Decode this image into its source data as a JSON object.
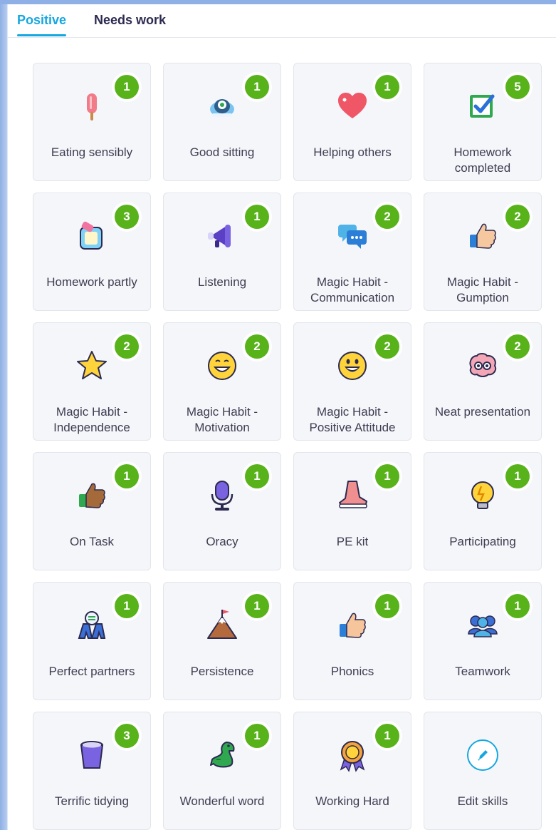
{
  "tabs": {
    "positive": "Positive",
    "needs_work": "Needs work"
  },
  "skills": [
    {
      "label": "Eating sensibly",
      "count": "1",
      "icon": "ice-lolly-icon"
    },
    {
      "label": "Good sitting",
      "count": "1",
      "icon": "monster-icon"
    },
    {
      "label": "Helping others",
      "count": "1",
      "icon": "heart-icon"
    },
    {
      "label": "Homework completed",
      "count": "5",
      "icon": "checkbox-icon"
    },
    {
      "label": "Homework partly",
      "count": "3",
      "icon": "eraser-note-icon"
    },
    {
      "label": "Listening",
      "count": "1",
      "icon": "megaphone-icon"
    },
    {
      "label": "Magic Habit - Communication",
      "count": "2",
      "icon": "speech-bubbles-icon"
    },
    {
      "label": "Magic Habit - Gumption",
      "count": "2",
      "icon": "thumbs-up-icon"
    },
    {
      "label": "Magic Habit - Independence",
      "count": "2",
      "icon": "star-icon"
    },
    {
      "label": "Magic Habit - Motivation",
      "count": "2",
      "icon": "grin-face-icon"
    },
    {
      "label": "Magic Habit - Positive Attitude",
      "count": "2",
      "icon": "smile-face-icon"
    },
    {
      "label": "Neat presentation",
      "count": "2",
      "icon": "brain-icon"
    },
    {
      "label": "On Task",
      "count": "1",
      "icon": "thumbs-up-brown-icon"
    },
    {
      "label": "Oracy",
      "count": "1",
      "icon": "microphone-icon"
    },
    {
      "label": "PE kit",
      "count": "1",
      "icon": "shoe-icon"
    },
    {
      "label": "Participating",
      "count": "1",
      "icon": "lightbulb-icon"
    },
    {
      "label": "Perfect partners",
      "count": "1",
      "icon": "partners-icon"
    },
    {
      "label": "Persistence",
      "count": "1",
      "icon": "mountain-flag-icon"
    },
    {
      "label": "Phonics",
      "count": "1",
      "icon": "thumbs-up-light-icon"
    },
    {
      "label": "Teamwork",
      "count": "1",
      "icon": "team-icon"
    },
    {
      "label": "Terrific tidying",
      "count": "3",
      "icon": "bin-icon"
    },
    {
      "label": "Wonderful word",
      "count": "1",
      "icon": "dinosaur-icon"
    },
    {
      "label": "Working Hard",
      "count": "1",
      "icon": "award-ribbon-icon"
    },
    {
      "label": "Edit skills",
      "count": "",
      "icon": "pencil-circle-icon"
    }
  ],
  "colors": {
    "accent": "#16a7e0",
    "badge": "#58b21a",
    "text": "#3e3d52"
  }
}
